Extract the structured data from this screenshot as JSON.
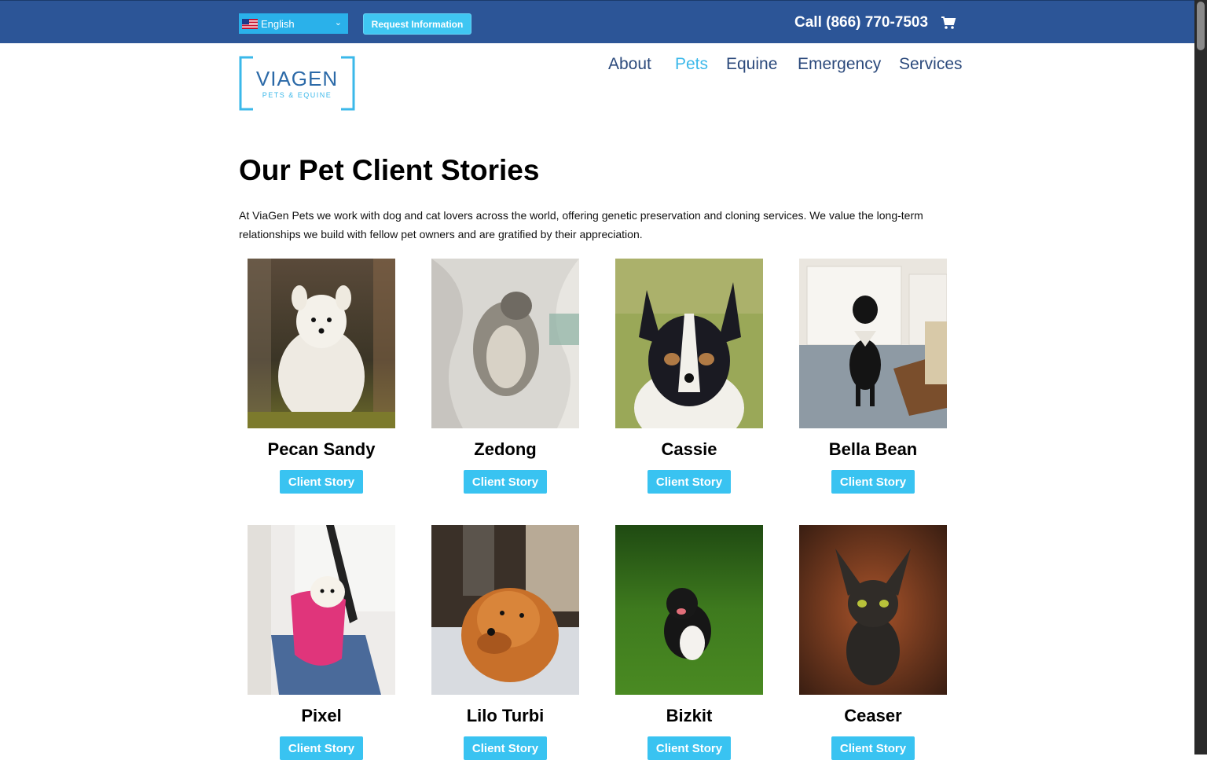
{
  "topbar": {
    "language": "English",
    "request_button": "Request Information",
    "phone": "Call (866) 770-7503"
  },
  "logo": {
    "name": "VIAGEN",
    "tagline": "PETS & EQUINE"
  },
  "nav": {
    "items": [
      "About",
      "Pets",
      "Equine",
      "Emergency",
      "Services"
    ],
    "active": "Pets"
  },
  "main": {
    "title": "Our Pet Client Stories",
    "intro_line1": "At ViaGen Pets we work with dog and cat lovers across the world, offering genetic preservation and cloning services. We value the long-term",
    "intro_line2": "relationships we build with fellow pet owners and are gratified by their appreciation.",
    "button_label": "Client Story",
    "pets": [
      {
        "name": "Pecan Sandy"
      },
      {
        "name": "Zedong"
      },
      {
        "name": "Cassie"
      },
      {
        "name": "Bella Bean"
      },
      {
        "name": "Pixel"
      },
      {
        "name": "Lilo Turbi"
      },
      {
        "name": "Bizkit"
      },
      {
        "name": "Ceaser"
      }
    ]
  },
  "colors": {
    "topbar": "#2c5597",
    "accent": "#39c3f1",
    "nav": "#2c4a7c",
    "nav_active": "#3bb8ea"
  }
}
